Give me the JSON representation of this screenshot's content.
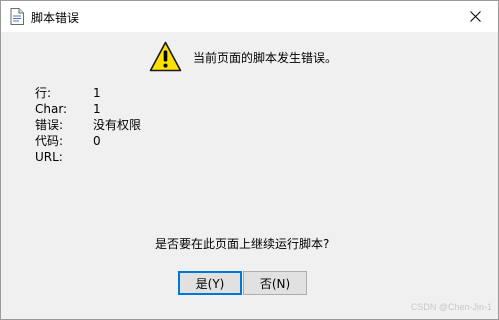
{
  "window": {
    "title": "脚本错误",
    "title_icon": "document-icon",
    "close_icon": "close-icon"
  },
  "message": {
    "icon": "warning-icon",
    "text": "当前页面的脚本发生错误。"
  },
  "details": [
    {
      "label": "行:",
      "value": "1"
    },
    {
      "label": "Char:",
      "value": "1"
    },
    {
      "label": "错误:",
      "value": "没有权限"
    },
    {
      "label": "代码:",
      "value": "0"
    },
    {
      "label": "URL:",
      "value": ""
    }
  ],
  "question": "是否要在此页面上继续运行脚本?",
  "buttons": {
    "yes": "是(Y)",
    "no": "否(N)"
  },
  "watermark": "CSDN @Chen-Jin-1"
}
